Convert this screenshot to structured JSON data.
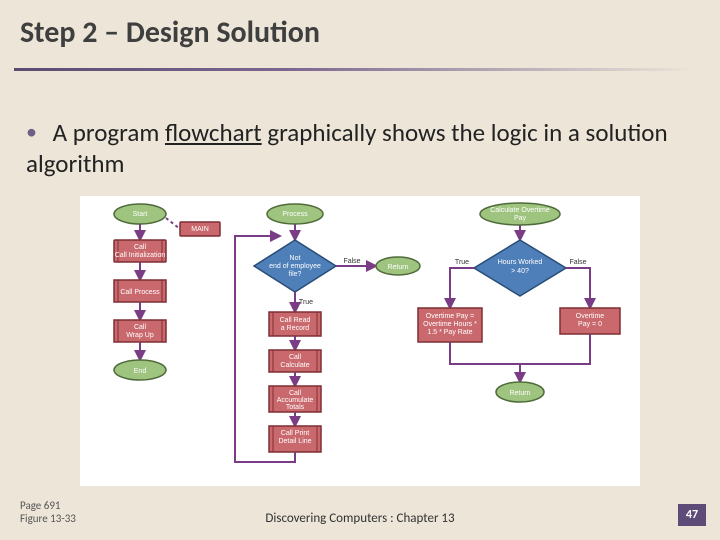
{
  "title": "Step 2 – Design Solution",
  "bullet": {
    "pre": "A program ",
    "term": "flowchart",
    "post": " graphically shows the logic in a solution algorithm"
  },
  "footer": {
    "page_ref": "Page 691",
    "figure_ref": "Figure 13-33",
    "center": "Discovering Computers : Chapter 13",
    "slide_number": "47"
  },
  "flowchart": {
    "type": "flowchart",
    "nodes": {
      "start": "Start",
      "main": "MAIN",
      "call_init": "Call Initialization",
      "call_process": "Call Process",
      "call_wrap": "Call Wrap Up",
      "end": "End",
      "process": "Process",
      "dec_eof": "Not end of employee file?",
      "return1": "Return",
      "call_read": "Call Read a Record",
      "call_calc": "Call Calculate",
      "call_accum": "Call Accumulate Totals",
      "call_print": "Call Print Detail Line",
      "calc_ot": "Calculate Overtime Pay",
      "dec_hours": "Hours Worked > 40?",
      "ot_formula": "Overtime Pay = Overtime Hours * 1.5 * Pay Rate",
      "ot_zero": "Overtime Pay = 0",
      "return2": "Return",
      "t": "True",
      "f": "False"
    }
  }
}
